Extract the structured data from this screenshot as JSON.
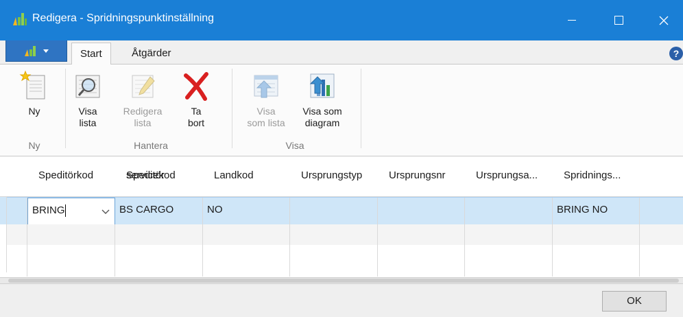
{
  "window": {
    "title": "Redigera - Spridningspunktinställning",
    "colors": {
      "titlebar": "#1a7fd6",
      "accent": "#2f74c2"
    }
  },
  "ribbon": {
    "tabs": [
      {
        "label": "Start",
        "active": true
      },
      {
        "label": "Åtgärder",
        "active": false
      }
    ],
    "help_label": "?",
    "buttons": {
      "ny": {
        "label_l1": "Ny",
        "label_l2": "",
        "icon": "new-document-icon"
      },
      "visa_lista": {
        "label_l1": "Visa",
        "label_l2": "lista",
        "icon": "view-list-icon"
      },
      "redigera_lista": {
        "label_l1": "Redigera",
        "label_l2": "lista",
        "icon": "edit-list-icon",
        "disabled": true
      },
      "ta_bort": {
        "label_l1": "Ta",
        "label_l2": "bort",
        "icon": "delete-x-icon"
      },
      "visa_som_lista": {
        "label_l1": "Visa",
        "label_l2": "som lista",
        "icon": "list-view-icon",
        "disabled": true
      },
      "visa_som_diagram": {
        "label_l1": "Visa som",
        "label_l2": "diagram",
        "icon": "chart-view-icon"
      }
    },
    "groups": {
      "ny": "Ny",
      "hantera": "Hantera",
      "visa": "Visa"
    }
  },
  "grid": {
    "columns": [
      {
        "label_l1": "Speditörkod",
        "label_l2": ""
      },
      {
        "label_l1": "Speditör",
        "label_l2": "servicekod"
      },
      {
        "label_l1": "Landkod",
        "label_l2": ""
      },
      {
        "label_l1": "Ursprungstyp",
        "label_l2": ""
      },
      {
        "label_l1": "Ursprungsnr",
        "label_l2": ""
      },
      {
        "label_l1": "Ursprungsa...",
        "label_l2": ""
      },
      {
        "label_l1": "Spridnings...",
        "label_l2": ""
      }
    ],
    "rows": [
      [
        "BRING",
        "BS CARGO",
        "NO",
        "",
        "",
        "",
        "BRING NO"
      ]
    ]
  },
  "footer": {
    "ok_label": "OK"
  }
}
